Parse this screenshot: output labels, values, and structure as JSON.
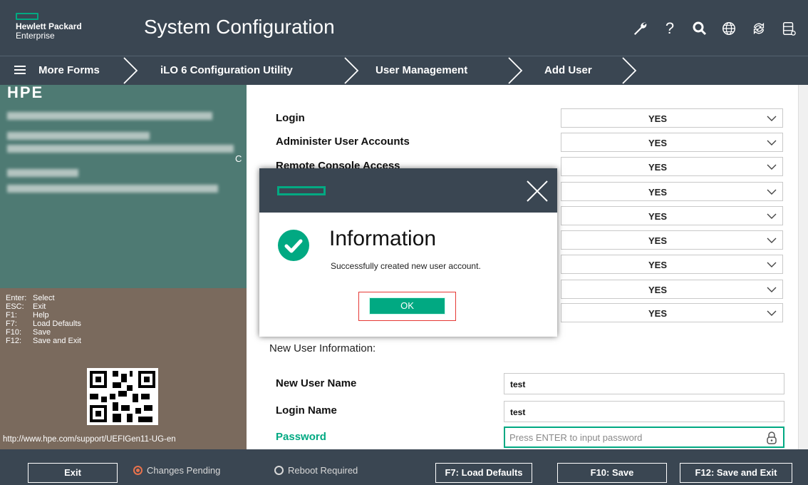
{
  "header": {
    "brand_line1": "Hewlett Packard",
    "brand_line2": "Enterprise",
    "title": "System Configuration",
    "icons": [
      "wrench-icon",
      "help-icon",
      "search-icon",
      "globe-icon",
      "refresh-icon",
      "storage-icon"
    ],
    "help_glyph": "?"
  },
  "breadcrumb": {
    "more_forms": "More Forms",
    "items": [
      "iLO 6 Configuration Utility",
      "User Management",
      "Add User"
    ]
  },
  "sidebar": {
    "brand_partial": "HPE",
    "suffix_char": "C",
    "keys": [
      {
        "key": "Enter:",
        "action": "Select"
      },
      {
        "key": "ESC:",
        "action": "Exit"
      },
      {
        "key": "F1:",
        "action": "Help"
      },
      {
        "key": "F7:",
        "action": "Load Defaults"
      },
      {
        "key": "F10:",
        "action": "Save"
      },
      {
        "key": "F12:",
        "action": "Save and Exit"
      }
    ],
    "url": "http://www.hpe.com/support/UEFIGen11-UG-en"
  },
  "privileges": {
    "rows": [
      {
        "label": "Login",
        "value": "YES"
      },
      {
        "label": "Administer User Accounts",
        "value": "YES"
      },
      {
        "label": "Remote Console Access",
        "value": "YES"
      },
      {
        "label": "",
        "value": "YES"
      },
      {
        "label": "",
        "value": "YES"
      },
      {
        "label": "",
        "value": "YES"
      },
      {
        "label": "",
        "value": "YES"
      },
      {
        "label": "",
        "value": "YES"
      },
      {
        "label": "",
        "value": "YES"
      }
    ]
  },
  "new_user": {
    "section_title": "New User Information:",
    "user_name_label": "New User Name",
    "user_name_value": "test",
    "login_name_label": "Login Name",
    "login_name_value": "test",
    "password_label": "Password",
    "password_placeholder": "Press ENTER to input password"
  },
  "dialog": {
    "title": "Information",
    "message": "Successfully created new user account.",
    "ok_label": "OK"
  },
  "footer": {
    "exit_label": "Exit",
    "changes_pending": "Changes Pending",
    "reboot_required": "Reboot Required",
    "load_defaults": "F7: Load Defaults",
    "save": "F10: Save",
    "save_exit": "F12: Save and Exit"
  },
  "colors": {
    "header_bg": "#3a4652",
    "accent": "#01a982",
    "sidebar_top": "#4e7a73",
    "sidebar_bottom": "#7a6a5d"
  }
}
